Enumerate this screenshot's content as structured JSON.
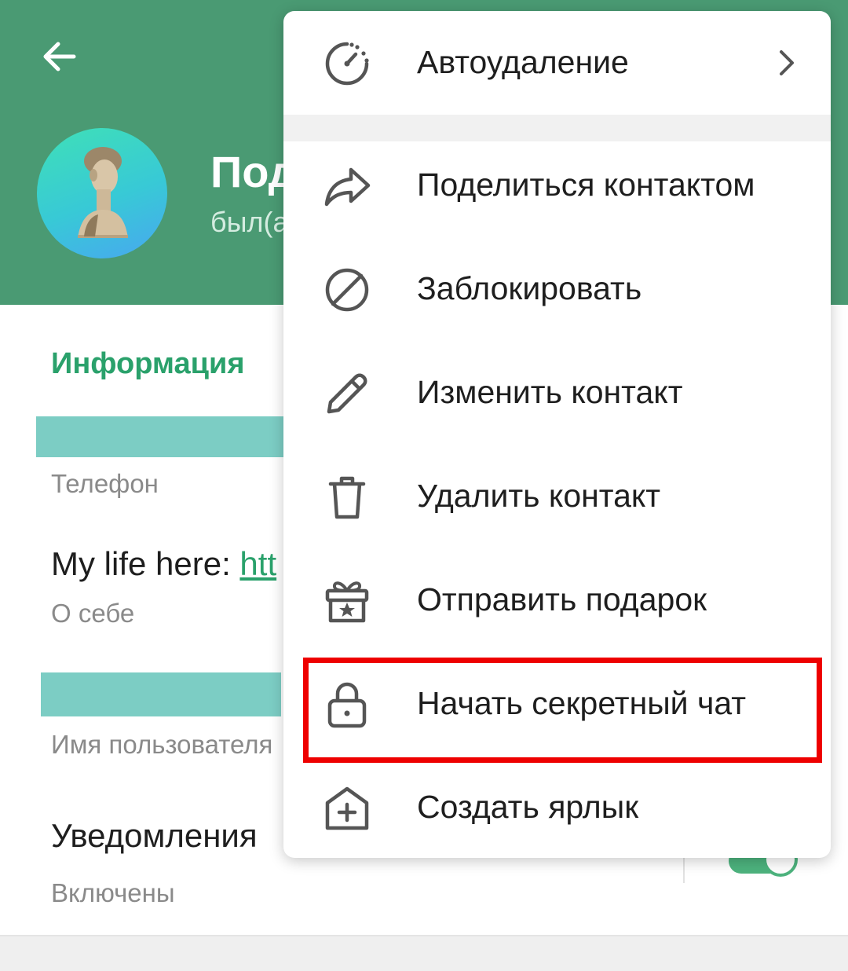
{
  "header": {
    "name": "Под",
    "status": "был(а",
    "colors": {
      "background": "#4a9a73"
    }
  },
  "info": {
    "section_title": "Информация",
    "phone_label": "Телефон",
    "bio_prefix": "My life here: ",
    "bio_link": "htt",
    "bio_label": "О себе",
    "username_label": "Имя пользователя",
    "notifications_title": "Уведомления",
    "notifications_status": "Включены",
    "notifications_enabled": true
  },
  "menu": {
    "items": [
      {
        "label": "Автоудаление",
        "icon": "timer-icon",
        "has_submenu": true
      },
      {
        "label": "Поделиться контактом",
        "icon": "share-icon"
      },
      {
        "label": "Заблокировать",
        "icon": "block-icon"
      },
      {
        "label": "Изменить контакт",
        "icon": "pencil-icon"
      },
      {
        "label": "Удалить контакт",
        "icon": "trash-icon"
      },
      {
        "label": "Отправить подарок",
        "icon": "gift-icon"
      },
      {
        "label": "Начать секретный чат",
        "icon": "lock-icon",
        "highlighted": true
      },
      {
        "label": "Создать ярлык",
        "icon": "add-shortcut-icon"
      }
    ]
  },
  "accent_colors": {
    "green": "#2aa16b",
    "highlight": "#ee0000",
    "redaction": "#7ccdc4"
  }
}
